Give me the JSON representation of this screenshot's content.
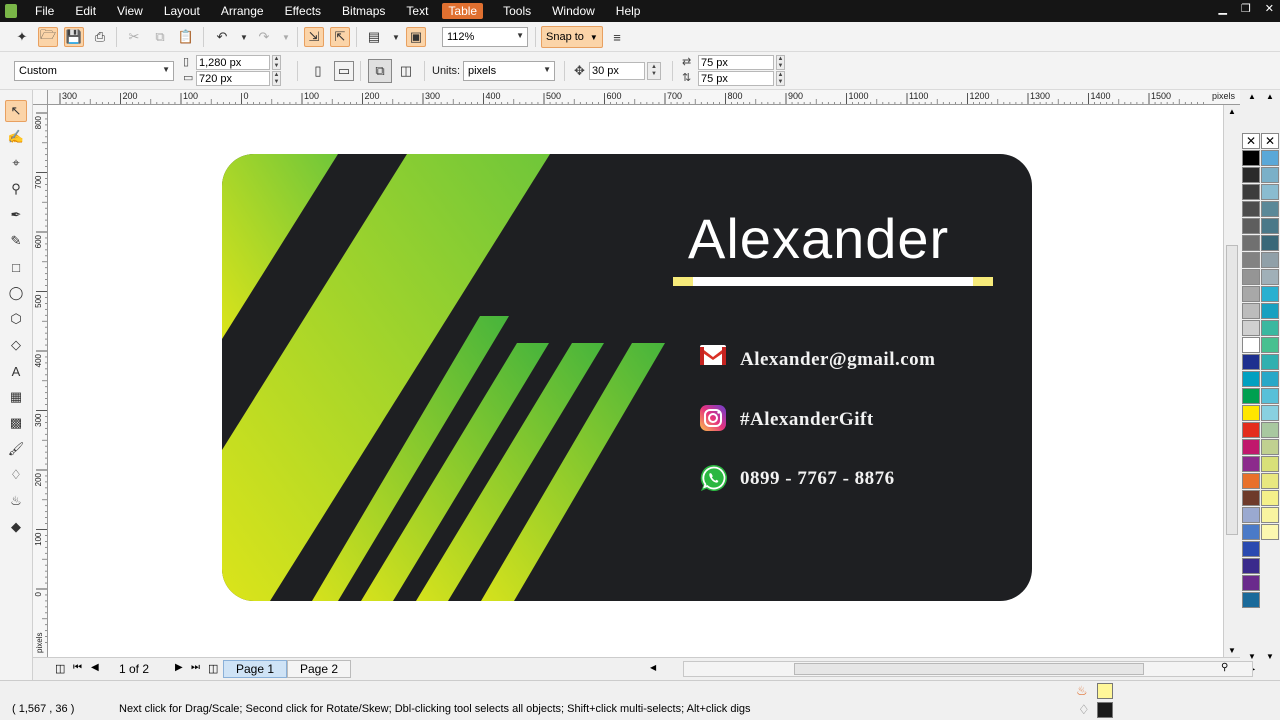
{
  "menu": {
    "items": [
      "File",
      "Edit",
      "View",
      "Layout",
      "Arrange",
      "Effects",
      "Bitmaps",
      "Text",
      "Table",
      "Tools",
      "Window",
      "Help"
    ],
    "active": "Table"
  },
  "toolbar": {
    "zoom": "112%",
    "snap_label": "Snap to",
    "page_preset": "Custom",
    "width": "1,280 px",
    "height": "720 px",
    "units_label": "Units:",
    "units_value": "pixels",
    "nudge": "30 px",
    "dup_x": "75 px",
    "dup_y": "75 px"
  },
  "rulers": {
    "h_ticks": [
      "300",
      "200",
      "100",
      "0",
      "100",
      "200",
      "300",
      "400",
      "500",
      "600",
      "700",
      "800",
      "900",
      "1000",
      "1100",
      "1200",
      "1300",
      "1400",
      "1500"
    ],
    "h_unit": "pixels",
    "v_ticks": [
      "800",
      "700",
      "600",
      "500",
      "400",
      "300",
      "200",
      "100",
      "0"
    ],
    "v_unit": "pixels"
  },
  "card": {
    "name": "Alexander",
    "email": "Alexander@gmail.com",
    "instagram": "#AlexanderGift",
    "phone": "0899 - 7767 - 8876"
  },
  "pages": {
    "counter": "1 of 2",
    "tabs": [
      "Page 1",
      "Page 2"
    ],
    "active": "Page 1"
  },
  "status": {
    "coords": "( 1,567 , 36    )",
    "message": "Next click for Drag/Scale; Second click for Rotate/Skew; Dbl-clicking tool selects all objects; Shift+click multi-selects; Alt+click digs",
    "fill_color": "#fff799",
    "outline_color": "#1a1a1a"
  },
  "palette": {
    "left_column": [
      "#000000",
      "#2b2b2b",
      "#3c3c3c",
      "#4d4d4d",
      "#5e5e5e",
      "#707070",
      "#828282",
      "#959595",
      "#a8a8a8",
      "#bcbcbc",
      "#d0d0d0",
      "#ffffff",
      "#1d2f8f",
      "#00a0c0",
      "#00a050",
      "#ffe600",
      "#e32d1c",
      "#c0186c",
      "#8c2a8c",
      "#e8702a",
      "#6e3a2a",
      "#9aa9d0",
      "#4a7ac8",
      "#2a4ab0",
      "#3a2a8c",
      "#6a2a8c",
      "#1a6a9a"
    ],
    "right_column": [
      "#5aa8d8",
      "#7ab0c8",
      "#8abcd0",
      "#5a8898",
      "#4a7888",
      "#3a6878",
      "#90a0a8",
      "#a0b0b8",
      "#28b0d0",
      "#18a0c0",
      "#3ab8a0",
      "#48c090",
      "#30b0b0",
      "#28a8c8",
      "#58c0d8",
      "#88d0e0",
      "#a8c8a0",
      "#c0d090",
      "#d8e078",
      "#e8e880",
      "#f4f08a",
      "#f8f4a0",
      "#fcf8b0"
    ]
  }
}
